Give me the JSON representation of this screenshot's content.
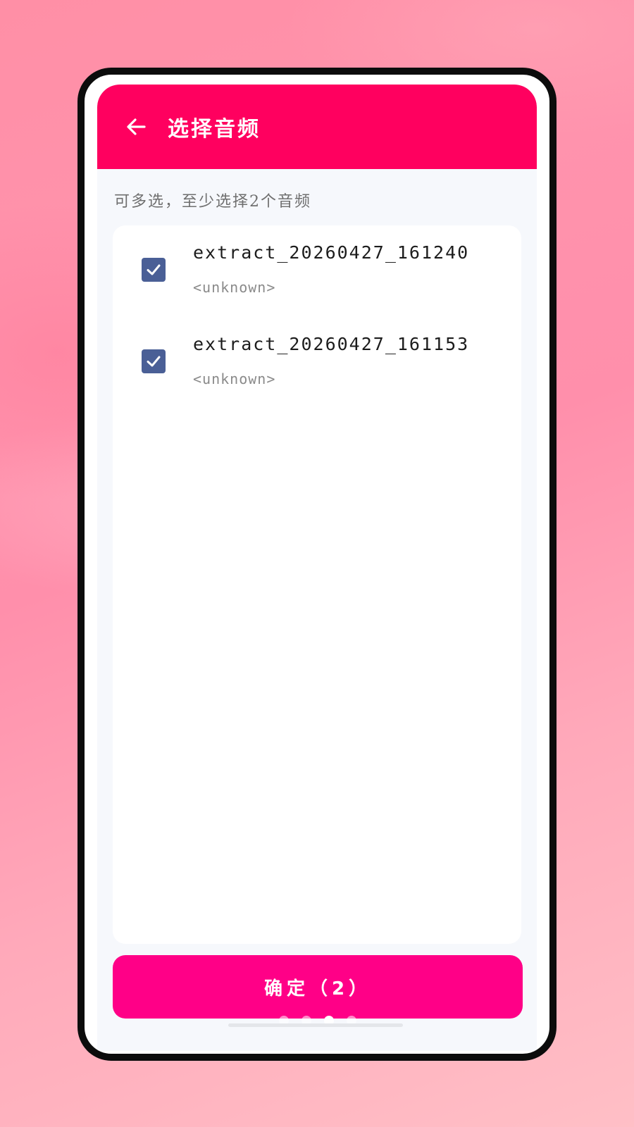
{
  "header": {
    "title": "选择音频",
    "back_icon": "arrow-left-icon"
  },
  "hint": "可多选，至少选择2个音频",
  "files": [
    {
      "name": "extract_20260427_161240",
      "meta": "<unknown>",
      "checked": true
    },
    {
      "name": "extract_20260427_161153",
      "meta": "<unknown>",
      "checked": true
    }
  ],
  "confirm_button": {
    "label": "确定（2）"
  },
  "pager": {
    "count": 4,
    "active_index": 2
  },
  "colors": {
    "header_bg": "#ff005f",
    "confirm_bg": "#ff0087",
    "checkbox": "#4a5f96"
  }
}
